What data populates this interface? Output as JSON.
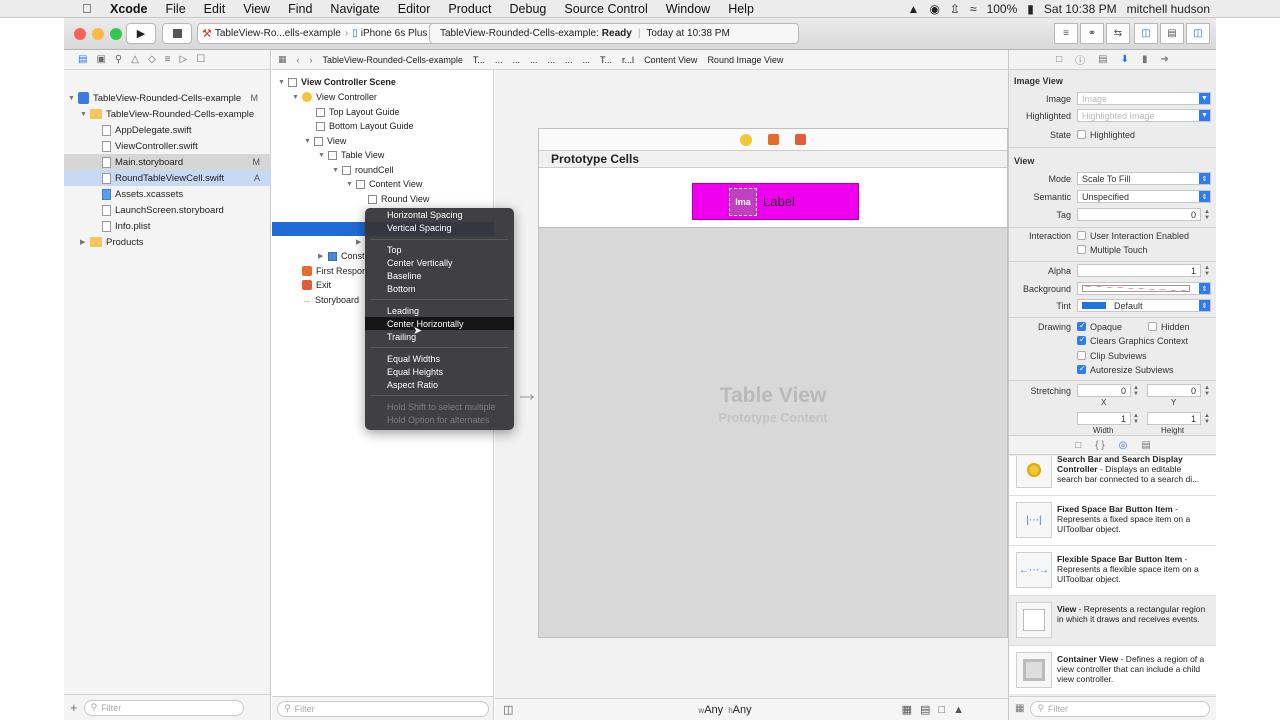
{
  "menubar": {
    "app": "Xcode",
    "items": [
      "File",
      "Edit",
      "View",
      "Find",
      "Navigate",
      "Editor",
      "Product",
      "Debug",
      "Source Control",
      "Window",
      "Help"
    ],
    "battery": "100%",
    "clock": "Sat 10:38 PM",
    "user": "mitchell hudson"
  },
  "toolbar": {
    "scheme": "TableView-Ro...ells-example",
    "device": "iPhone 6s Plus",
    "status_project": "TableView-Rounded-Cells-example:",
    "status_state": "Ready",
    "status_time": "Today at 10:38 PM"
  },
  "navigator": {
    "project": "TableView-Rounded-Cells-example",
    "project_badge": "M",
    "group": "TableView-Rounded-Cells-example",
    "files": [
      {
        "name": "AppDelegate.swift",
        "badge": ""
      },
      {
        "name": "ViewController.swift",
        "badge": ""
      },
      {
        "name": "Main.storyboard",
        "badge": "M"
      },
      {
        "name": "RoundTableViewCell.swift",
        "badge": "A"
      },
      {
        "name": "Assets.xcassets",
        "badge": ""
      },
      {
        "name": "LaunchScreen.storyboard",
        "badge": ""
      },
      {
        "name": "Info.plist",
        "badge": ""
      }
    ],
    "products": "Products",
    "filter_placeholder": "Filter"
  },
  "jumpbar": {
    "crumbs": [
      "TableView-Rounded-Cells-example",
      "T...",
      "...",
      "...",
      "...",
      "...",
      "...",
      "...",
      "T...",
      "r...l",
      "Content View",
      "Round Image View"
    ]
  },
  "outline": {
    "scene": "View Controller Scene",
    "items": {
      "view_controller": "View Controller",
      "top_guide": "Top Layout Guide",
      "bottom_guide": "Bottom Layout Guide",
      "view": "View",
      "table_view": "Table View",
      "round_cell": "roundCell",
      "content_view": "Content View",
      "round_view": "Round View",
      "constraints": "Const",
      "first_responder": "First Respon",
      "exit": "Exit",
      "storyboard": "Storyboard"
    },
    "filter_placeholder": "Filter"
  },
  "canvas": {
    "prototype_header": "Prototype Cells",
    "image_label": "Ima",
    "cell_label": "Label",
    "table_title": "Table View",
    "table_subtitle": "Prototype Content",
    "size_w": "w",
    "size_w_val": "Any",
    "size_h": "h",
    "size_h_val": "Any"
  },
  "popover": {
    "items": [
      "Horizontal Spacing",
      "Vertical Spacing",
      "Top",
      "Center Vertically",
      "Baseline",
      "Bottom",
      "Leading",
      "Center Horizontally",
      "Trailing",
      "Equal Widths",
      "Equal Heights",
      "Aspect Ratio"
    ],
    "hints": [
      "Hold Shift to select multiple",
      "Hold Option for alternates"
    ]
  },
  "inspector": {
    "image_view_header": "Image View",
    "image_label": "Image",
    "image_placeholder": "Image",
    "highlighted_label": "Highlighted",
    "highlighted_placeholder": "Highlighted Image",
    "state_label": "State",
    "state_check": "Highlighted",
    "view_header": "View",
    "mode_label": "Mode",
    "mode_value": "Scale To Fill",
    "semantic_label": "Semantic",
    "semantic_value": "Unspecified",
    "tag_label": "Tag",
    "tag_value": "0",
    "interaction_label": "Interaction",
    "user_interaction": "User Interaction Enabled",
    "multiple_touch": "Multiple Touch",
    "alpha_label": "Alpha",
    "alpha_value": "1",
    "background_label": "Background",
    "tint_label": "Tint",
    "tint_value": "Default",
    "drawing_label": "Drawing",
    "opaque": "Opaque",
    "hidden": "Hidden",
    "clears": "Clears Graphics Context",
    "clip": "Clip Subviews",
    "autoresize": "Autoresize Subviews",
    "stretching_label": "Stretching",
    "stretch_x": "0",
    "stretch_y": "0",
    "x_label": "X",
    "y_label": "Y",
    "stretch_w": "1",
    "stretch_h": "1",
    "width_label": "Width",
    "height_label": "Height"
  },
  "library": {
    "items": [
      {
        "title": "Search Bar and Search Display Controller",
        "desc": " - Displays an editable search bar connected to a search di..."
      },
      {
        "title": "Fixed Space Bar Button Item",
        "desc": " - Represents a fixed space item on a UIToolbar object."
      },
      {
        "title": "Flexible Space Bar Button Item",
        "desc": " - Represents a flexible space item on a UIToolbar object."
      },
      {
        "title": "View",
        "desc": " - Represents a rectangular region in which it draws and receives events."
      },
      {
        "title": "Container View",
        "desc": " - Defines a region of a view controller that can include a child view controller."
      }
    ],
    "filter_placeholder": "Filter"
  },
  "colors": {
    "accent": "#2f7cf0",
    "cell_magenta": "#ee00ee",
    "selection_blue": "#1f6bd6"
  }
}
